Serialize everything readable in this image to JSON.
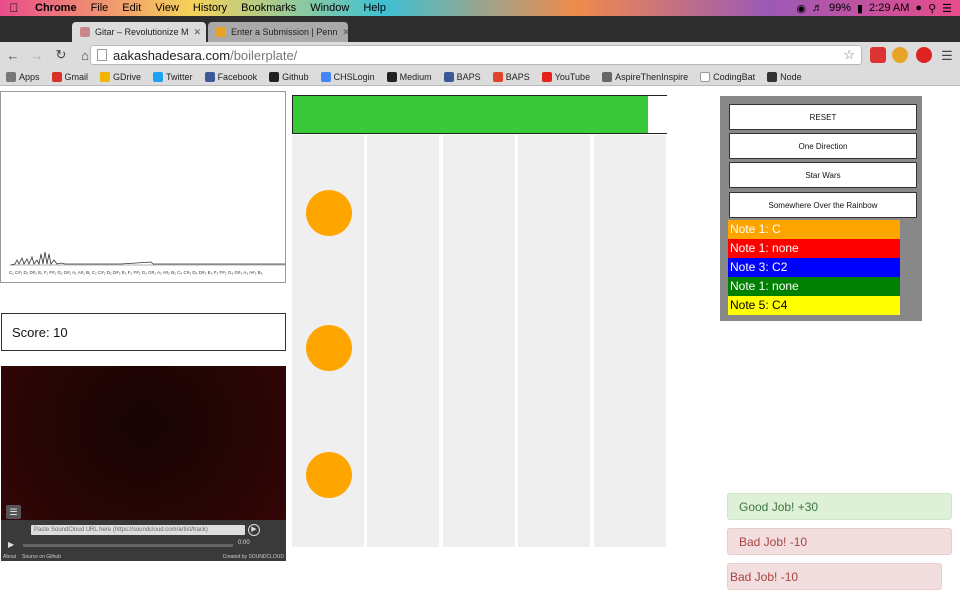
{
  "menubar": {
    "app_name": "Chrome",
    "items": [
      "File",
      "Edit",
      "View",
      "History",
      "Bookmarks",
      "Window",
      "Help"
    ],
    "battery": "99%",
    "clock": "2:29 AM"
  },
  "tabs": [
    {
      "title": "Gitar – Revolutionize M",
      "active": true
    },
    {
      "title": "Enter a Submission | Penn",
      "active": false
    }
  ],
  "address": {
    "host": "aakashadesara.com",
    "path": "/boilerplate/"
  },
  "bookmarks": [
    {
      "label": "Apps",
      "color": "#777777"
    },
    {
      "label": "Gmail",
      "color": "#d93025"
    },
    {
      "label": "GDrive",
      "color": "#f4b400"
    },
    {
      "label": "Twitter",
      "color": "#1da1f2"
    },
    {
      "label": "Facebook",
      "color": "#3b5998"
    },
    {
      "label": "Github",
      "color": "#222222"
    },
    {
      "label": "CHSLogin",
      "color": "#4285f4"
    },
    {
      "label": "Medium",
      "color": "#222222"
    },
    {
      "label": "BAPS",
      "color": "#3b5998"
    },
    {
      "label": "BAPS",
      "color": "#e0452b"
    },
    {
      "label": "YouTube",
      "color": "#e62117"
    },
    {
      "label": "AspireThenInspire",
      "color": "#666666"
    },
    {
      "label": "CodingBat",
      "color": "#ffffff"
    },
    {
      "label": "Node",
      "color": "#333333"
    }
  ],
  "visualizer": {
    "note_labels": "C₁ C#₁ D₁ D#₁ E₁ F₁ F#₁ G₁ G#₁ A₁ A#₁ B₁ C₂ C#₂ D₂ D#₂ E₂ F₂ F#₂ G₂ G#₂ A₂ A#₂ B₂ C₃ C#₃ D₃ D#₃ E₃ F₃ F#₃ G₃ G#₃ A₃ A#₃ B₃"
  },
  "score": {
    "text": "Score: 10"
  },
  "player": {
    "url_placeholder": "Paste SoundCloud URL here (https://soundcloud.com/artist/track)",
    "time": "0:00",
    "about": "About",
    "source": "Source on Github",
    "credit": "Created by SOUNDCLOUD"
  },
  "game": {
    "progress": 0.95,
    "lanes": 5,
    "lane_color": "#efefef",
    "bar_color": "#39c939",
    "note_color": "#ffa500"
  },
  "controls": {
    "buttons": [
      "RESET",
      "One Direction",
      "Star Wars",
      "Somewhere Over the Rainbow"
    ],
    "notes": [
      {
        "text": "Note 1: C",
        "color": "#ffa500",
        "text_color": "#ffffff"
      },
      {
        "text": "Note 1: none",
        "color": "#ff0000",
        "text_color": "#ffffff"
      },
      {
        "text": "Note 3: C2",
        "color": "#0000ff",
        "text_color": "#ffffff"
      },
      {
        "text": "Note 1: none",
        "color": "#008000",
        "text_color": "#ffffff"
      },
      {
        "text": "Note 5: C4",
        "color": "#ffff00",
        "text_color": "#000000"
      }
    ]
  },
  "feedback": [
    {
      "text": "Good Job! +30",
      "type": "good"
    },
    {
      "text": "Bad Job! -10",
      "type": "bad"
    },
    {
      "text": "Bad Job! -10",
      "type": "bad"
    }
  ]
}
